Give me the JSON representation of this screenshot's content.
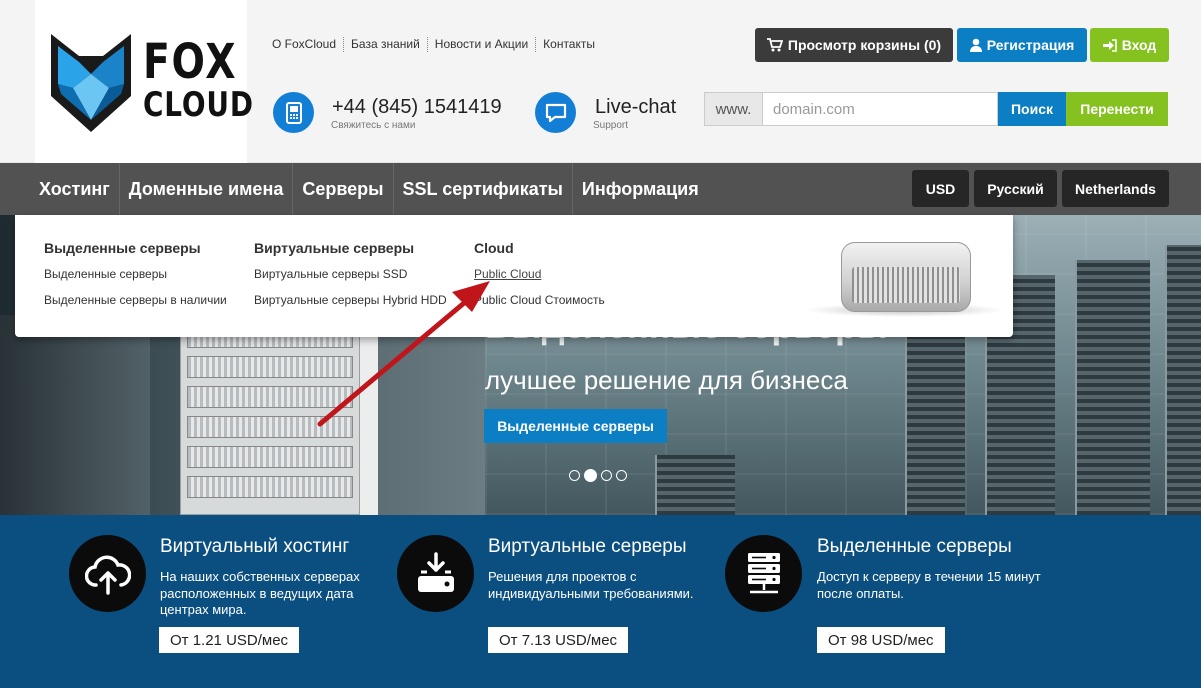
{
  "logo": {
    "line1": "FOX",
    "line2": "CLOUD"
  },
  "toplinks": [
    "О FoxCloud",
    "База знаний",
    "Новости и Акции",
    "Контакты"
  ],
  "buttons": {
    "cart": "Просмотр корзины (0)",
    "register": "Регистрация",
    "login": "Вход"
  },
  "contact": {
    "phone": "+44 (845) 1541419",
    "phone_sub": "Свяжитесь с нами",
    "chat": "Live-chat",
    "chat_sub": "Support"
  },
  "domain": {
    "prefix": "www.",
    "placeholder": "domain.com",
    "search": "Поиск",
    "transfer": "Перенести"
  },
  "nav": {
    "items": [
      "Хостинг",
      "Доменные имена",
      "Серверы",
      "SSL сертификаты",
      "Информация"
    ],
    "currency": "USD",
    "language": "Русский",
    "country": "Netherlands"
  },
  "dropdown": {
    "columns": [
      {
        "heading": "Выделенные серверы",
        "links": [
          "Выделенные серверы",
          "Выделенные серверы в наличии"
        ]
      },
      {
        "heading": "Виртуальные серверы",
        "links": [
          "Виртуальные серверы SSD",
          "Виртуальные серверы Hybrid HDD"
        ]
      },
      {
        "heading": "Cloud",
        "links": [
          "Public Cloud",
          "Public Cloud Стоимость"
        ]
      }
    ]
  },
  "hero": {
    "title": "Выделенные серверы",
    "subtitle": "лучшее решение для бизнеса",
    "button": "Выделенные серверы",
    "slides_total": 4,
    "slide_active": 2
  },
  "features": [
    {
      "title": "Виртуальный хостинг",
      "desc": "На наших собственных серверах расположенных в ведущих дата центрах мира.",
      "price": "От 1.21 USD/мес",
      "icon": "cloud-upload-icon"
    },
    {
      "title": "Виртуальные серверы",
      "desc": "Решения для проектов с индивидуальными требованиями.",
      "price": "От 7.13 USD/мес",
      "icon": "hdd-download-icon"
    },
    {
      "title": "Выделенные серверы",
      "desc": "Доступ к серверу в течении 15 минут после оплаты.",
      "price": "От 98 USD/мес",
      "icon": "server-stack-icon"
    }
  ],
  "colors": {
    "blue": "#0c7ec4",
    "green": "#85c11f",
    "navy": "#0b4f80",
    "nav": "#525252",
    "arrow": "#c0161b"
  }
}
